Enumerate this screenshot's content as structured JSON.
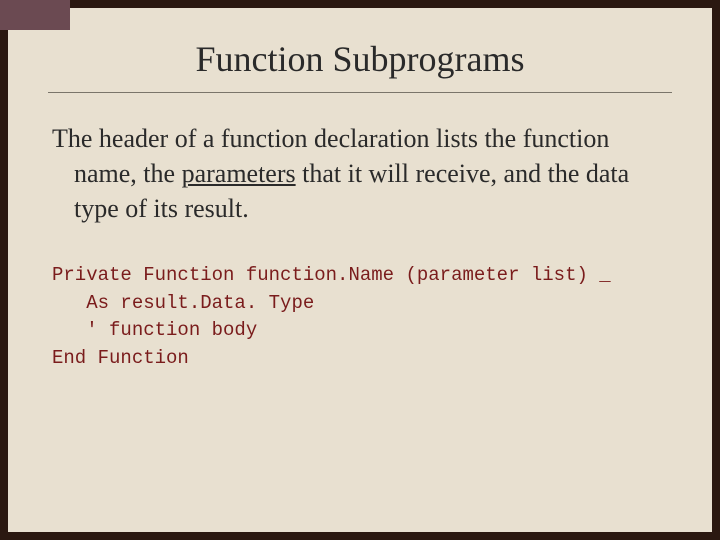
{
  "title": "Function Subprograms",
  "body": {
    "pre": "The header of a function declaration lists the function name, the ",
    "underlined": "parameters",
    "post": " that it will receive, and the data type of its result."
  },
  "code": {
    "line1": "Private Function function.Name (parameter list) _",
    "line2": "   As result.Data. Type",
    "line3": "   ' function body",
    "line4": "End Function"
  }
}
